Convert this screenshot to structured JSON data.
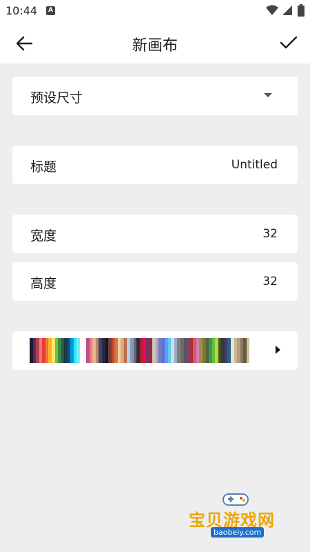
{
  "status_bar": {
    "time": "10:44",
    "icons": [
      "a-notification-icon",
      "wifi-icon",
      "signal-icon",
      "battery-icon"
    ]
  },
  "app_bar": {
    "title": "新画布",
    "back_icon": "arrow-left-icon",
    "confirm_icon": "check-icon"
  },
  "preset": {
    "label": "预设尺寸",
    "icon": "dropdown-arrow-icon"
  },
  "title_field": {
    "label": "标题",
    "value": "Untitled"
  },
  "width_field": {
    "label": "宽度",
    "value": "32"
  },
  "height_field": {
    "label": "高度",
    "value": "32"
  },
  "palette": {
    "icon": "play-arrow-icon",
    "colors": [
      "#1a1c2c",
      "#5d275d",
      "#b13e53",
      "#ef7d57",
      "#e43b44",
      "#f77622",
      "#feae34",
      "#fee761",
      "#63c74d",
      "#3e8948",
      "#265c42",
      "#193c3e",
      "#124e89",
      "#0099db",
      "#2ce8f5",
      "#73eff7",
      "#ffffff",
      "#f4f4f4",
      "#b55088",
      "#f6757a",
      "#e8b796",
      "#c28569",
      "#3a4466",
      "#262b44",
      "#181425",
      "#733e39",
      "#be4a2f",
      "#d77643",
      "#ead4aa",
      "#e4a672",
      "#b86f50",
      "#c0cbdc",
      "#8b9bb4",
      "#5a6988",
      "#3e2731",
      "#a22633",
      "#ff0044",
      "#68386c",
      "#9e2835",
      "#cfc6b8",
      "#a5a3c8",
      "#7a7ab0",
      "#5b6ee1",
      "#639bff",
      "#5fcde4",
      "#cbdbfc",
      "#9badb7",
      "#847e87",
      "#696a6a",
      "#595652",
      "#76428a",
      "#ac3232",
      "#d95763",
      "#d77bba",
      "#8f974a",
      "#8a6f30",
      "#4b692f",
      "#37946e",
      "#6abe30",
      "#99e550",
      "#524b24",
      "#323c39",
      "#3f3f74",
      "#306082",
      "#dfe6d8",
      "#c8b890",
      "#b0a080",
      "#8c7860",
      "#6a5840",
      "#d0c0a0"
    ]
  },
  "watermark": {
    "text": "宝贝游戏网",
    "url": "baobeiy.com"
  }
}
